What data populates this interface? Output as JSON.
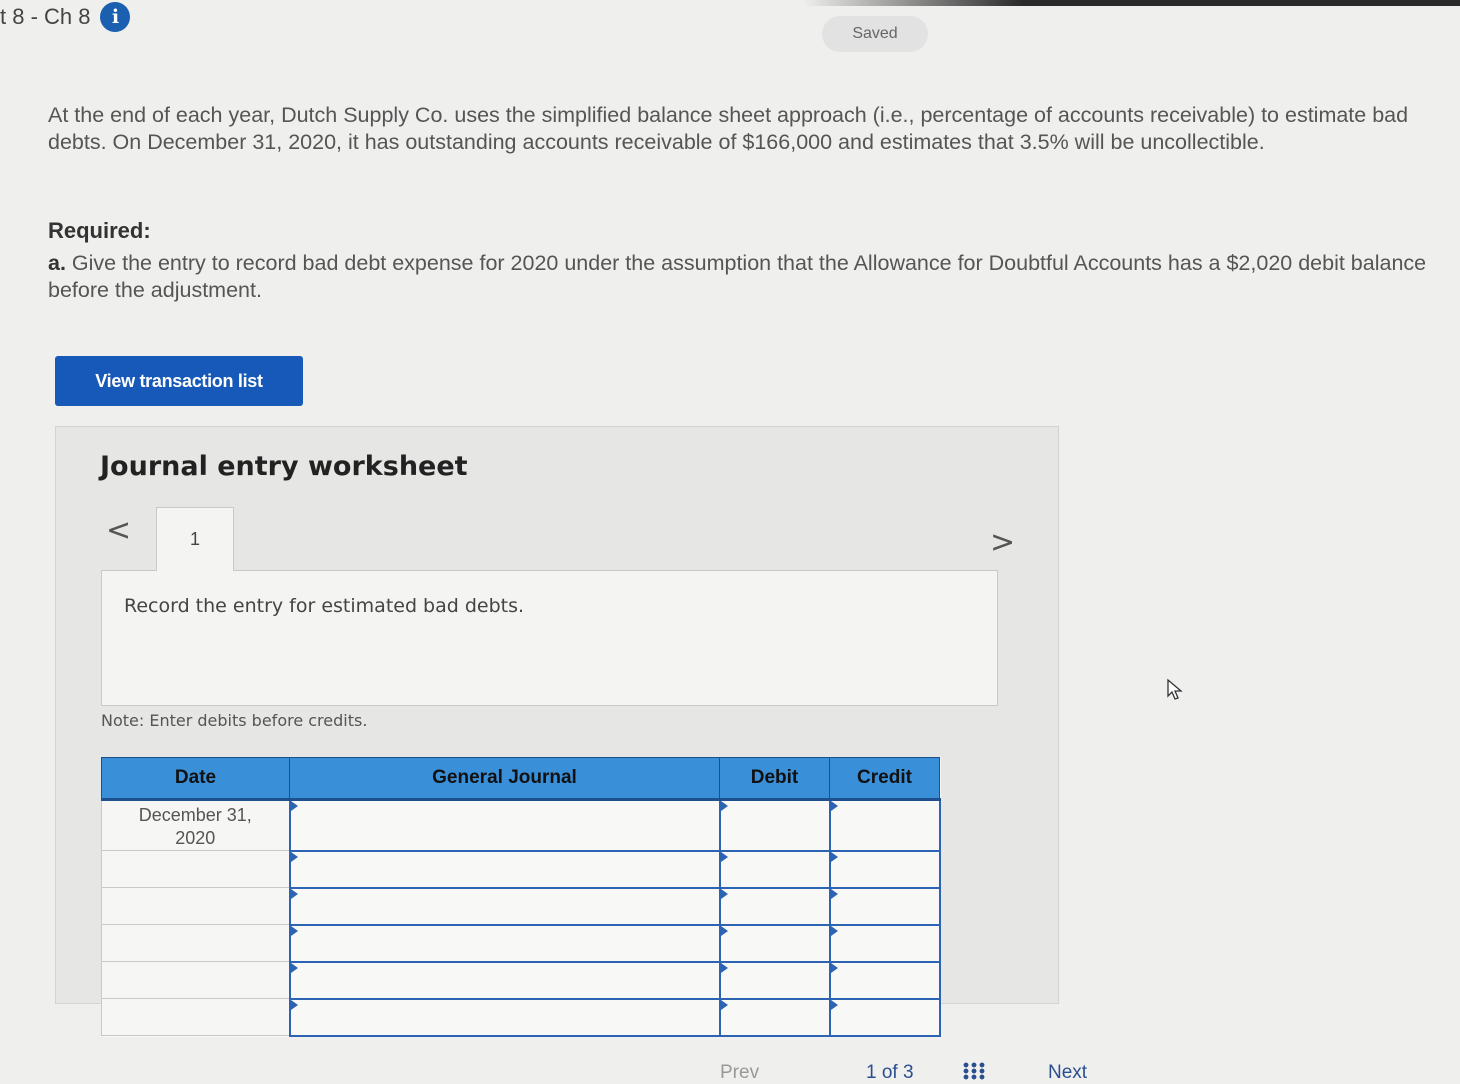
{
  "assignment": {
    "title": "t 8 - Ch 8",
    "info_icon_glyph": "i",
    "saved_label": "Saved"
  },
  "problem": {
    "text": "At the end of each year, Dutch Supply Co. uses the simplified balance sheet approach (i.e., percentage of accounts receivable) to estimate bad debts. On December 31, 2020, it has outstanding accounts receivable of $166,000 and estimates that 3.5% will be uncollectible."
  },
  "required": {
    "heading": "Required:",
    "part_label": "a.",
    "part_text": "Give the entry to record bad debt expense for 2020 under the assumption that the Allowance for Doubtful Accounts has a $2,020 debit balance before the adjustment."
  },
  "buttons": {
    "view_transaction_list": "View transaction list"
  },
  "worksheet": {
    "title": "Journal entry worksheet",
    "prev_glyph": "<",
    "next_glyph": ">",
    "tabs": [
      {
        "label": "1"
      }
    ],
    "instruction": "Record the entry for estimated bad debts.",
    "note": "Note: Enter debits before credits.",
    "columns": {
      "date": "Date",
      "general_journal": "General Journal",
      "debit": "Debit",
      "credit": "Credit"
    },
    "rows": [
      {
        "date_line1": "December 31,",
        "date_line2": "2020",
        "account": "",
        "debit": "",
        "credit": ""
      },
      {
        "date_line1": "",
        "date_line2": "",
        "account": "",
        "debit": "",
        "credit": ""
      },
      {
        "date_line1": "",
        "date_line2": "",
        "account": "",
        "debit": "",
        "credit": ""
      },
      {
        "date_line1": "",
        "date_line2": "",
        "account": "",
        "debit": "",
        "credit": ""
      },
      {
        "date_line1": "",
        "date_line2": "",
        "account": "",
        "debit": "",
        "credit": ""
      },
      {
        "date_line1": "",
        "date_line2": "",
        "account": "",
        "debit": "",
        "credit": ""
      }
    ]
  },
  "pagination": {
    "prev_label": "Prev",
    "position": "1 of 3",
    "next_label": "Next"
  },
  "colors": {
    "primary_button": "#1659b8",
    "table_header": "#3a8fd9",
    "input_border": "#2d63b3",
    "info_icon": "#1a5fb0"
  }
}
